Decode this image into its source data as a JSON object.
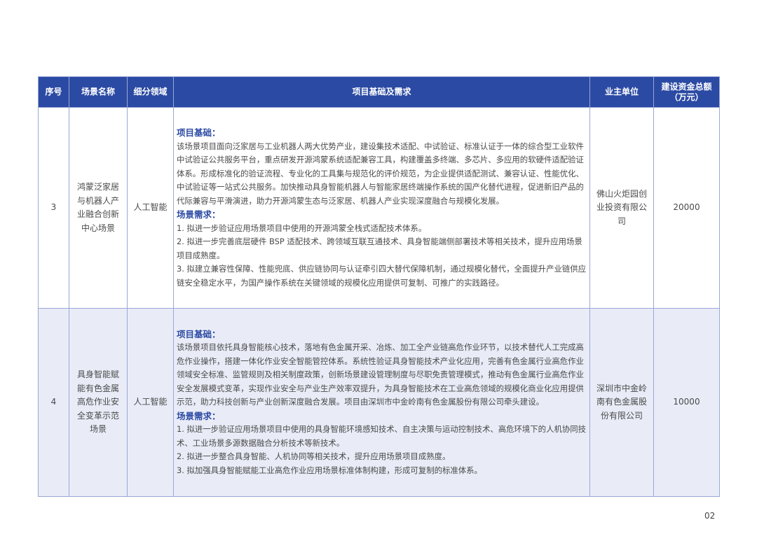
{
  "table": {
    "headers": [
      "序号",
      "场景名称",
      "细分领域",
      "项目基础及需求",
      "业主单位",
      "建设资金总额（万元）"
    ],
    "rows": [
      {
        "index": "3",
        "scene_name": "鸿蒙泛家居与机器人产业融合创新中心场景",
        "field": "人工智能",
        "basis_title": "项目基础：",
        "basis_text": "该场景项目面向泛家居与工业机器人两大优势产业，建设集技术适配、中试验证、标准认证于一体的综合型工业软件中试验证公共服务平台，重点研发开源鸿蒙系统适配兼容工具，构建覆盖多终端、多芯片、多应用的软硬件适配验证体系。形成标准化的验证流程、专业化的工具集与规范化的评价规范，为企业提供适配测试、兼容认证、性能优化、中试验证等一站式公共服务。加快推动具身智能机器人与智能家居终端操作系统的国产化替代进程，促进新旧产品的代际兼容与平滑演进，助力开源鸿蒙生态与泛家居、机器人产业实现深度融合与规模化发展。",
        "needs_title": "场景需求：",
        "needs": [
          "1. 拟进一步验证应用场景项目中使用的开源鸿蒙全栈式适配技术体系。",
          "2. 拟进一步完善底层硬件 BSP 适配技术、跨领域互联互通技术、具身智能端侧部署技术等相关技术，提升应用场景项目成熟度。",
          "3. 拟建立兼容性保障、性能兜底、供应链协同与认证牵引四大替代保障机制，通过规模化替代，全面提升产业链供应链安全稳定水平，为国产操作系统在关键领域的规模化应用提供可复制、可推广的实践路径。"
        ],
        "owner": "佛山火炬园创业投资有限公司",
        "funding": "20000"
      },
      {
        "index": "4",
        "scene_name": "具身智能赋能有色金属高危作业安全变革示范场景",
        "field": "人工智能",
        "basis_title": "项目基础：",
        "basis_text": "该场景项目依托具身智能核心技术，落地有色金属开采、冶炼、加工全产业链高危作业环节，以技术替代人工完成高危作业操作，搭建一体化作业安全智能管控体系。系统性验证具身智能技术产业化应用，完善有色金属行业高危作业领域安全标准、监管规则及相关制度政策，创新场景建设管理制度与尽职免责管理模式，推动有色金属行业高危作业安全发展模式变革，实现作业安全与产业生产效率双提升，为具身智能技术在工业高危领域的规模化商业化应用提供示范，助力科技创新与产业创新深度融合发展。项目由深圳市中金岭南有色金属股份有限公司牵头建设。",
        "needs_title": "场景需求：",
        "needs": [
          "1. 拟进一步验证应用场景项目中使用的具身智能环境感知技术、自主决策与运动控制技术、高危环境下的人机协同技术、工业场景多源数据融合分析技术等新技术。",
          "2. 拟进一步整合具身智能、人机协同等相关技术，提升应用场景项目成熟度。",
          "3. 拟加强具身智能赋能工业高危作业应用场景标准体制构建，形成可复制的标准体系。"
        ],
        "owner": "深圳市中金岭南有色金属股份有限公司",
        "funding": "10000"
      }
    ]
  },
  "page_number": "02"
}
